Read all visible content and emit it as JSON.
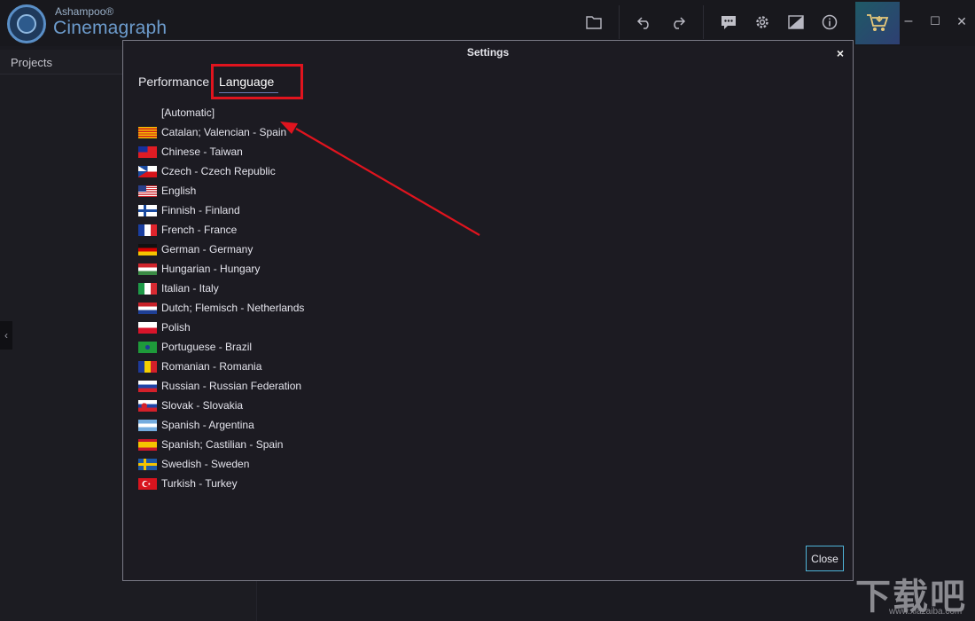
{
  "app": {
    "brand_top": "Ashampoo®",
    "brand_main": "Cinemagraph",
    "accent": "#4fb3d9"
  },
  "toolbar": {
    "icons": [
      "folder-icon",
      "undo-icon",
      "redo-icon",
      "chat-icon",
      "gear-icon",
      "aspect-icon",
      "info-icon",
      "cart-icon"
    ]
  },
  "window_controls": {
    "minimize": "–",
    "maximize": "☐",
    "close": "✕"
  },
  "left_panel": {
    "projects_label": "Projects"
  },
  "dialog": {
    "title": "Settings",
    "close_x": "×",
    "tabs": [
      {
        "label": "Performance",
        "active": false
      },
      {
        "label": "Language",
        "active": true
      }
    ],
    "languages": [
      {
        "label": "[Automatic]",
        "flag": "none"
      },
      {
        "label": "Catalan; Valencian - Spain",
        "flag": "catalan"
      },
      {
        "label": "Chinese - Taiwan",
        "flag": "taiwan"
      },
      {
        "label": "Czech - Czech Republic",
        "flag": "czech"
      },
      {
        "label": "English",
        "flag": "usa"
      },
      {
        "label": "Finnish - Finland",
        "flag": "finland"
      },
      {
        "label": "French - France",
        "flag": "france"
      },
      {
        "label": "German - Germany",
        "flag": "germany"
      },
      {
        "label": "Hungarian - Hungary",
        "flag": "hungary"
      },
      {
        "label": "Italian - Italy",
        "flag": "italy"
      },
      {
        "label": "Dutch; Flemisch - Netherlands",
        "flag": "netherlands"
      },
      {
        "label": "Polish",
        "flag": "poland"
      },
      {
        "label": "Portuguese - Brazil",
        "flag": "brazil"
      },
      {
        "label": "Romanian - Romania",
        "flag": "romania"
      },
      {
        "label": "Russian - Russian Federation",
        "flag": "russia"
      },
      {
        "label": "Slovak - Slovakia",
        "flag": "slovakia"
      },
      {
        "label": "Spanish - Argentina",
        "flag": "argentina"
      },
      {
        "label": "Spanish; Castilian - Spain",
        "flag": "spain"
      },
      {
        "label": "Swedish - Sweden",
        "flag": "sweden"
      },
      {
        "label": "Turkish - Turkey",
        "flag": "turkey"
      }
    ],
    "close_button": "Close"
  },
  "annotation": {
    "color": "#e0141e"
  },
  "watermark": {
    "main": "下载吧",
    "sub": "www.xiazaiba.com"
  }
}
